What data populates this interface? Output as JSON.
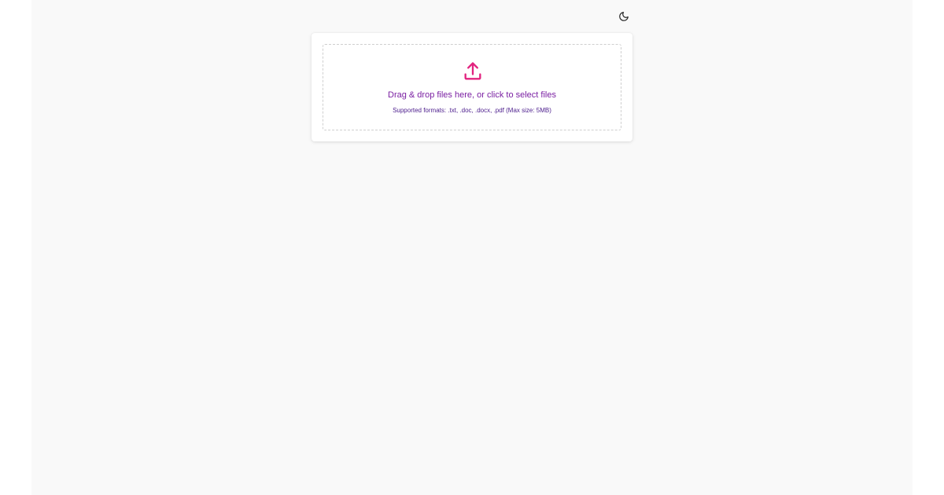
{
  "theme_toggle": {
    "icon": "moon-icon"
  },
  "upload": {
    "icon": "upload-icon",
    "accent_color": "#e2237f",
    "primary_text": "Drag & drop files here, or click to select files",
    "secondary_text": "Supported formats: .txt, .doc, .docx, .pdf (Max size: 5MB)"
  }
}
